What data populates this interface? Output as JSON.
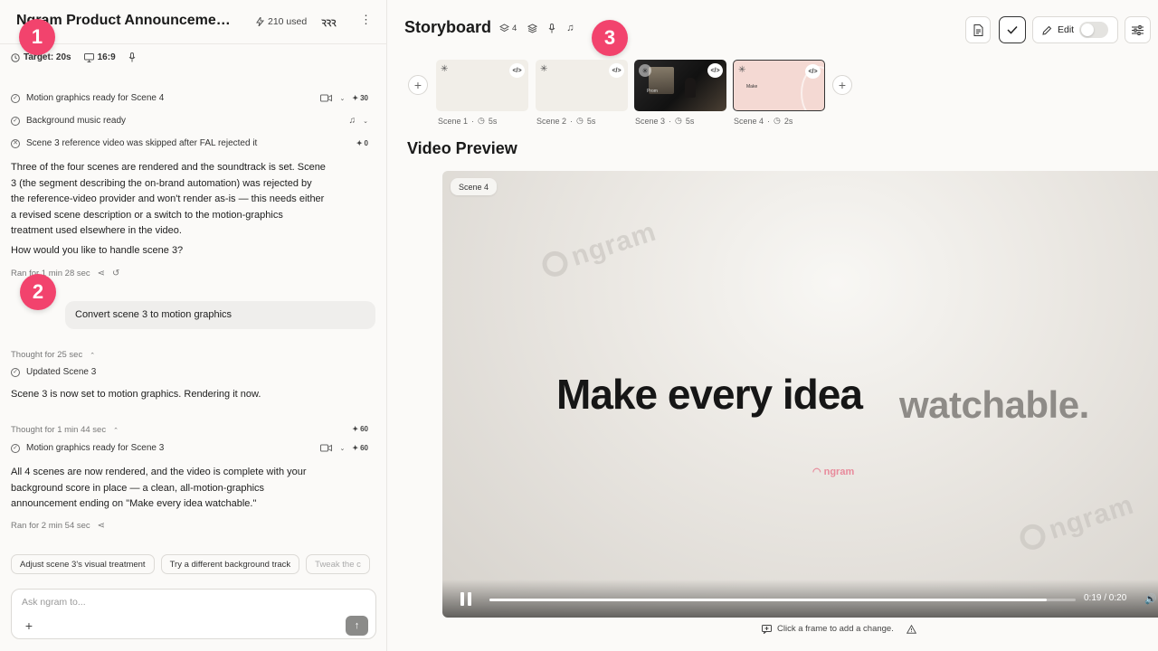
{
  "header": {
    "title": "Ngram Product Announcement Video",
    "used": "210 used",
    "logo": "ꝚꝚꝚ",
    "target_label": "Target: 20s",
    "aspect": "16:9"
  },
  "feed": {
    "status1": "Motion graphics ready for Scene 4",
    "status1_credits": "30",
    "status2": "Background music ready",
    "status3": "Scene 3 reference video was skipped after FAL rejected it",
    "status3_credits": "0",
    "para1": "Three of the four scenes are rendered and the soundtrack is set. Scene 3 (the segment describing the on-brand automation) was rejected by the reference-video provider and won't render as-is — this needs either a revised scene description or a switch to the motion-graphics treatment used elsewhere in the video.",
    "para2": "How would you like to handle scene 3?",
    "meta1": "Ran for 1 min 28 sec",
    "user_message": "Convert scene 3 to motion graphics",
    "thought1": "Thought for 25 sec",
    "status4": "Updated Scene 3",
    "para3": "Scene 3 is now set to motion graphics. Rendering it now.",
    "thought2": "Thought for 1 min 44 sec",
    "thought2_credits": "60",
    "status5": "Motion graphics ready for Scene 3",
    "status5_credits": "60",
    "para4": "All 4 scenes are now rendered, and the video is complete with your background score in place — a clean, all-motion-graphics announcement ending on \"Make every idea watchable.\"",
    "meta2": "Ran for 2 min 54 sec"
  },
  "chips": [
    "Adjust scene 3's visual treatment",
    "Try a different background track",
    "Tweak the c"
  ],
  "composer": {
    "placeholder": "Ask ngram to..."
  },
  "badges": [
    "1",
    "2",
    "3"
  ],
  "storyboard": {
    "title": "Storyboard",
    "scene_count": "4",
    "scenes": [
      {
        "label": "Scene 1",
        "duration": "5s"
      },
      {
        "label": "Scene 2",
        "duration": "5s"
      },
      {
        "label": "Scene 3",
        "duration": "5s",
        "tiny": "Prom"
      },
      {
        "label": "Scene 4",
        "duration": "2s",
        "tiny": "Make"
      }
    ]
  },
  "toolbar": {
    "edit_label": "Edit"
  },
  "preview": {
    "title": "Video Preview",
    "scene_pill": "Scene 4",
    "headline_main": "Make every idea",
    "headline_accent": "watchable.",
    "watermark": "ngram",
    "brand_mini": "ngram",
    "time": "0:19 / 0:20",
    "progress": 0.95
  },
  "hint": "Click a frame to add a change.",
  "colors": {
    "badge": "#f2436d",
    "accent_pink": "#e88a9b"
  }
}
